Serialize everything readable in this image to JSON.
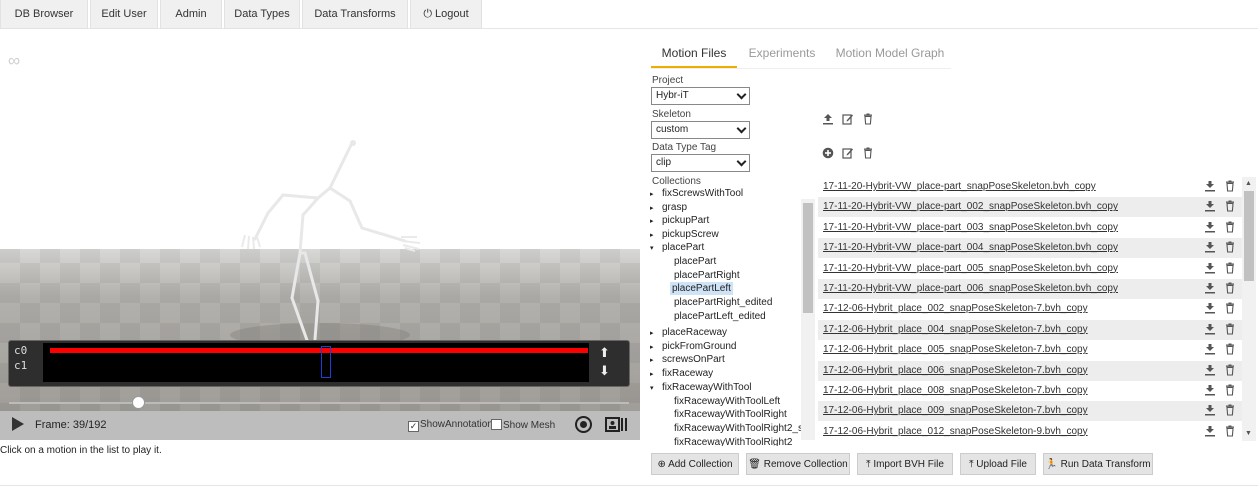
{
  "nav": {
    "db_browser": "DB Browser",
    "edit_user": "Edit User",
    "admin": "Admin",
    "data_types": "Data Types",
    "data_transforms": "Data Transforms",
    "logout": "Logout"
  },
  "viewer": {
    "annotation_labels": [
      "c0",
      "c1"
    ],
    "frame_label": "Frame: 39/192",
    "frame_current": 39,
    "frame_total": 192,
    "show_annotation_label": "ShowAnnotation",
    "show_annotation_checked": true,
    "show_mesh_label": "Show Mesh",
    "show_mesh_checked": false,
    "annotation_color": "#ff0000",
    "hint": "Click on a motion in the list to play it."
  },
  "tabs": [
    {
      "label": "Motion Files",
      "active": true
    },
    {
      "label": "Experiments",
      "active": false
    },
    {
      "label": "Motion Model Graph",
      "active": false
    }
  ],
  "filters": {
    "project_label": "Project",
    "project_value": "Hybr-iT",
    "skeleton_label": "Skeleton",
    "skeleton_value": "custom",
    "tag_label": "Data Type Tag",
    "tag_value": "clip"
  },
  "collections_label": "Collections",
  "collections": [
    {
      "label": "fixScrewsWithTool",
      "twisty": "▸"
    },
    {
      "label": "grasp",
      "twisty": "▸"
    },
    {
      "label": "pickupPart",
      "twisty": "▸"
    },
    {
      "label": "pickupScrew",
      "twisty": "▸"
    },
    {
      "label": "placePart",
      "twisty": "▾"
    },
    {
      "label": "placePart",
      "twisty": "",
      "child": true
    },
    {
      "label": "placePartRight",
      "twisty": "",
      "child": true
    },
    {
      "label": "placePartLeft",
      "twisty": "",
      "child": true,
      "selected": true
    },
    {
      "label": "placePartRight_edited",
      "twisty": "",
      "child": true
    },
    {
      "label": "placePartLeft_edited",
      "twisty": "",
      "child": true
    },
    {
      "label": "placeRaceway",
      "twisty": "▸"
    },
    {
      "label": "pickFromGround",
      "twisty": "▸"
    },
    {
      "label": "screwsOnPart",
      "twisty": "▸"
    },
    {
      "label": "fixRaceway",
      "twisty": "▸"
    },
    {
      "label": "fixRacewayWithTool",
      "twisty": "▾"
    },
    {
      "label": "fixRacewayWithToolLeft",
      "twisty": "",
      "child": true
    },
    {
      "label": "fixRacewayWithToolRight",
      "twisty": "",
      "child": true
    },
    {
      "label": "fixRacewayWithToolRight2_s",
      "twisty": "",
      "child": true
    },
    {
      "label": "fixRacewayWithToolRight2",
      "twisty": "",
      "child": true
    }
  ],
  "files": [
    "17-11-20-Hybrit-VW_place-part_snapPoseSkeleton.bvh_copy",
    "17-11-20-Hybrit-VW_place-part_002_snapPoseSkeleton.bvh_copy",
    "17-11-20-Hybrit-VW_place-part_003_snapPoseSkeleton.bvh_copy",
    "17-11-20-Hybrit-VW_place-part_004_snapPoseSkeleton.bvh_copy",
    "17-11-20-Hybrit-VW_place-part_005_snapPoseSkeleton.bvh_copy",
    "17-11-20-Hybrit-VW_place-part_006_snapPoseSkeleton.bvh_copy",
    "17-12-06-Hybrit_place_002_snapPoseSkeleton-7.bvh_copy",
    "17-12-06-Hybrit_place_004_snapPoseSkeleton-7.bvh_copy",
    "17-12-06-Hybrit_place_005_snapPoseSkeleton-7.bvh_copy",
    "17-12-06-Hybrit_place_006_snapPoseSkeleton-7.bvh_copy",
    "17-12-06-Hybrit_place_008_snapPoseSkeleton-7.bvh_copy",
    "17-12-06-Hybrit_place_009_snapPoseSkeleton-7.bvh_copy",
    "17-12-06-Hybrit_place_012_snapPoseSkeleton-9.bvh_copy"
  ],
  "actions": {
    "add_collection": "Add Collection",
    "remove_collection": "Remove Collection",
    "import_bvh": "Import BVH File",
    "upload_file": "Upload File",
    "run_transform": "Run Data Transform"
  },
  "icons": {
    "upload": "upload-icon",
    "edit": "edit-icon",
    "delete": "trash-icon",
    "add": "plus-circle-icon",
    "download": "download-icon"
  },
  "colors": {
    "tab_accent": "#f0ad00",
    "selected_row": "#cfe3f7"
  }
}
